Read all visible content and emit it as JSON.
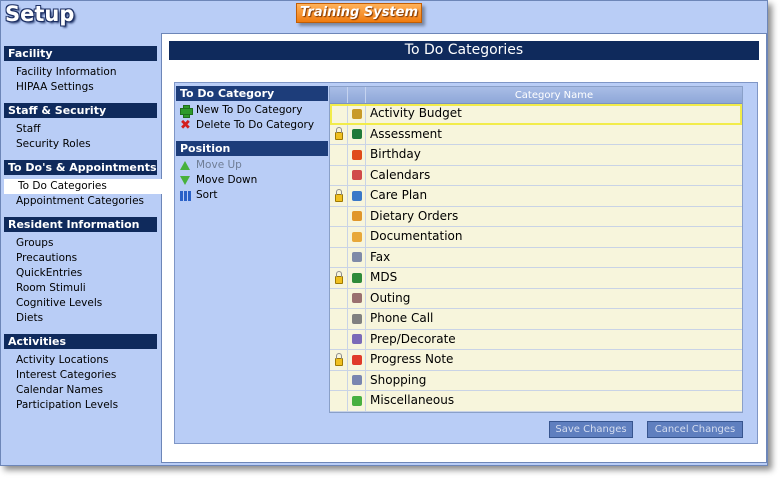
{
  "app": {
    "title": "Setup",
    "banner": "Training System"
  },
  "sidebar": {
    "sections": [
      {
        "title": "Facility",
        "items": [
          "Facility Information",
          "HIPAA Settings"
        ]
      },
      {
        "title": "Staff & Security",
        "items": [
          "Staff",
          "Security Roles"
        ]
      },
      {
        "title": "To Do's & Appointments",
        "items": [
          "To Do Categories",
          "Appointment Categories"
        ]
      },
      {
        "title": "Resident Information",
        "items": [
          "Groups",
          "Precautions",
          "QuickEntries",
          "Room Stimuli",
          "Cognitive Levels",
          "Diets"
        ]
      },
      {
        "title": "Activities",
        "items": [
          "Activity Locations",
          "Interest Categories",
          "Calendar Names",
          "Participation Levels"
        ]
      }
    ],
    "selected": "To Do Categories"
  },
  "main": {
    "title": "To Do Categories",
    "tools": {
      "category_header": "To Do Category",
      "new_label": "New To Do Category",
      "delete_label": "Delete To Do Category",
      "position_header": "Position",
      "move_up_label": "Move Up",
      "move_down_label": "Move Down",
      "sort_label": "Sort"
    },
    "grid": {
      "column_header": "Category Name",
      "rows": [
        {
          "name": "Activity Budget",
          "locked": false,
          "icon": "money-bag-icon",
          "color": "#c89a28"
        },
        {
          "name": "Assessment",
          "locked": true,
          "icon": "assessment-icon",
          "color": "#1f7a3a"
        },
        {
          "name": "Birthday",
          "locked": false,
          "icon": "candle-icon",
          "color": "#e04b1a"
        },
        {
          "name": "Calendars",
          "locked": false,
          "icon": "calendar-icon",
          "color": "#d04a4a"
        },
        {
          "name": "Care Plan",
          "locked": true,
          "icon": "care-plan-icon",
          "color": "#3a78c8"
        },
        {
          "name": "Dietary Orders",
          "locked": false,
          "icon": "food-icon",
          "color": "#e0962a"
        },
        {
          "name": "Documentation",
          "locked": false,
          "icon": "document-icon",
          "color": "#e8a83a"
        },
        {
          "name": "Fax",
          "locked": false,
          "icon": "fax-icon",
          "color": "#7f8aa8"
        },
        {
          "name": "MDS",
          "locked": true,
          "icon": "checkbox-icon",
          "color": "#2e8a3a"
        },
        {
          "name": "Outing",
          "locked": false,
          "icon": "outing-icon",
          "color": "#9a7070"
        },
        {
          "name": "Phone Call",
          "locked": false,
          "icon": "phone-icon",
          "color": "#808080"
        },
        {
          "name": "Prep/Decorate",
          "locked": false,
          "icon": "decorate-icon",
          "color": "#7a6ab8"
        },
        {
          "name": "Progress Note",
          "locked": true,
          "icon": "progress-note-icon",
          "color": "#e03a2a"
        },
        {
          "name": "Shopping",
          "locked": false,
          "icon": "cart-icon",
          "color": "#7a86b0"
        },
        {
          "name": "Miscellaneous",
          "locked": false,
          "icon": "star-icon",
          "color": "#48b040"
        }
      ],
      "selected_row": "Activity Budget"
    },
    "buttons": {
      "save": "Save Changes",
      "cancel": "Cancel Changes"
    }
  }
}
